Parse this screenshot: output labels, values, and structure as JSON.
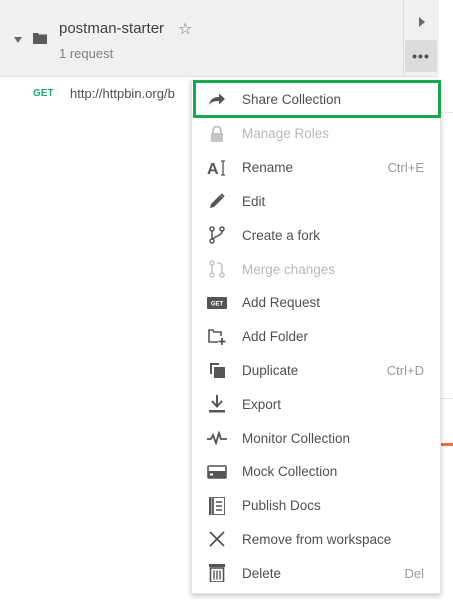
{
  "collection": {
    "name": "postman-starter",
    "subtitle": "1 request"
  },
  "request": {
    "method": "GET",
    "url": "http://httpbin.org/b"
  },
  "menu": {
    "items": [
      {
        "label": "Share Collection",
        "icon": "share-arrow-icon",
        "shortcut": "",
        "disabled": false,
        "highlighted": true
      },
      {
        "label": "Manage Roles",
        "icon": "lock-icon",
        "shortcut": "",
        "disabled": true
      },
      {
        "label": "Rename",
        "icon": "rename-icon",
        "shortcut": "Ctrl+E",
        "disabled": false
      },
      {
        "label": "Edit",
        "icon": "pencil-icon",
        "shortcut": "",
        "disabled": false
      },
      {
        "label": "Create a fork",
        "icon": "fork-icon",
        "shortcut": "",
        "disabled": false
      },
      {
        "label": "Merge changes",
        "icon": "merge-icon",
        "shortcut": "",
        "disabled": true
      },
      {
        "label": "Add Request",
        "icon": "get-request-icon",
        "shortcut": "",
        "disabled": false
      },
      {
        "label": "Add Folder",
        "icon": "add-folder-icon",
        "shortcut": "",
        "disabled": false
      },
      {
        "label": "Duplicate",
        "icon": "duplicate-icon",
        "shortcut": "Ctrl+D",
        "disabled": false
      },
      {
        "label": "Export",
        "icon": "export-icon",
        "shortcut": "",
        "disabled": false
      },
      {
        "label": "Monitor Collection",
        "icon": "monitor-pulse-icon",
        "shortcut": "",
        "disabled": false
      },
      {
        "label": "Mock Collection",
        "icon": "mock-server-icon",
        "shortcut": "",
        "disabled": false
      },
      {
        "label": "Publish Docs",
        "icon": "docs-icon",
        "shortcut": "",
        "disabled": false
      },
      {
        "label": "Remove from workspace",
        "icon": "close-x-icon",
        "shortcut": "",
        "disabled": false
      },
      {
        "label": "Delete",
        "icon": "trash-icon",
        "shortcut": "Del",
        "disabled": false
      }
    ]
  },
  "colors": {
    "highlight": "#1aa551",
    "get_method": "#2aa57a",
    "accent": "#e8704a"
  }
}
